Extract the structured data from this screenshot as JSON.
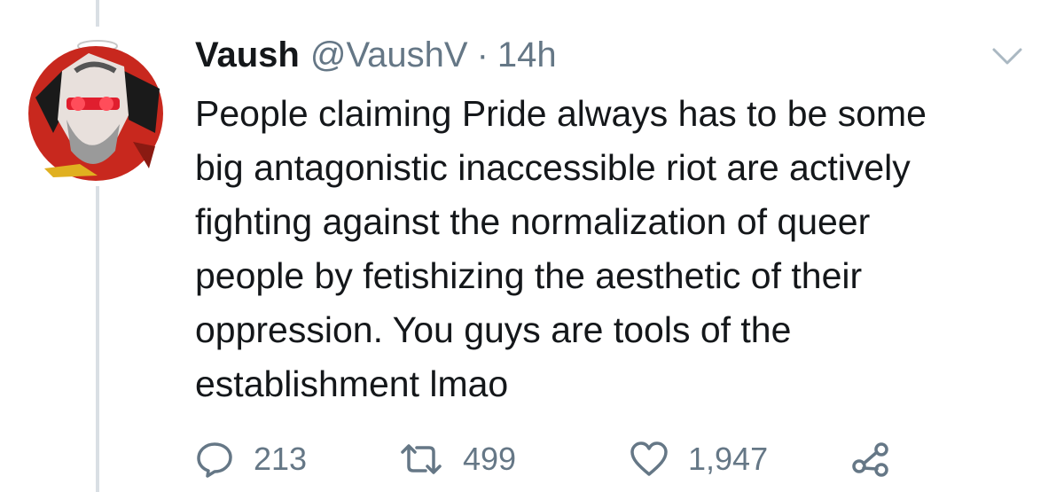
{
  "tweet": {
    "display_name": "Vaush",
    "handle": "@VaushV",
    "separator": "·",
    "time": "14h",
    "text_lines": [
      "People claiming Pride always has to be some",
      "big antagonistic inaccessible riot are actively",
      "fighting against the normalization of queer",
      "people by fetishizing the aesthetic of their",
      "oppression. You guys are tools of the",
      "establishment lmao"
    ],
    "avatar_icon": "cartoon-avatar-icon",
    "menu_icon": "chevron-down-icon"
  },
  "actions": {
    "reply": {
      "icon": "reply-icon",
      "count": "213"
    },
    "retweet": {
      "icon": "retweet-icon",
      "count": "499"
    },
    "like": {
      "icon": "heart-icon",
      "count": "1,947"
    },
    "share": {
      "icon": "share-icon"
    }
  },
  "colors": {
    "text": "#14171a",
    "muted": "#657786",
    "thread_line": "#d9dfe4"
  }
}
